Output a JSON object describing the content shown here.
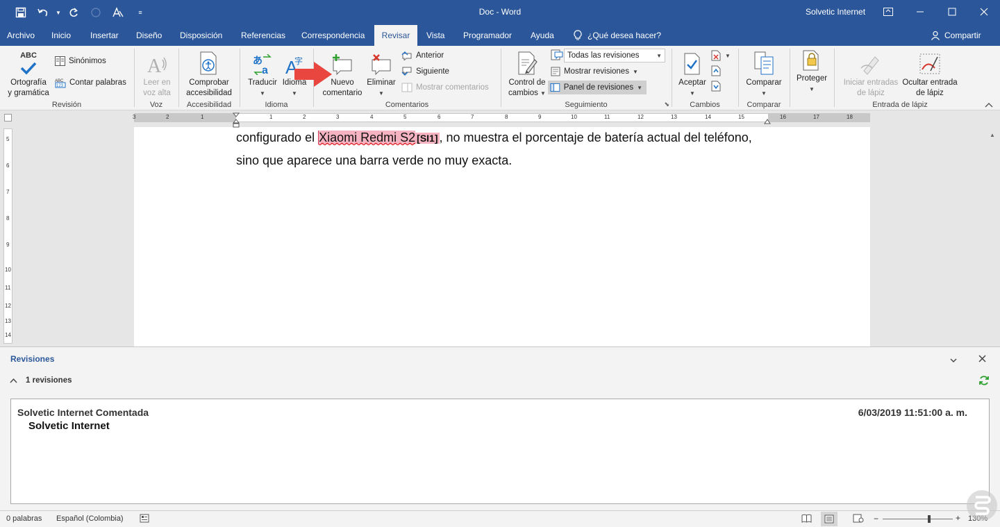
{
  "window": {
    "doc_title": "Doc - Word",
    "user": "Solvetic Internet",
    "qat_icons": [
      "save-icon",
      "undo-icon",
      "redo-icon",
      "autosave-icon",
      "touch-mode-icon",
      "customize-qat-icon"
    ],
    "buttons": [
      "ribbon-display-options-icon",
      "minimize-icon",
      "maximize-icon",
      "close-icon"
    ]
  },
  "tabs": [
    "Archivo",
    "Inicio",
    "Insertar",
    "Diseño",
    "Disposición",
    "Referencias",
    "Correspondencia",
    "Revisar",
    "Vista",
    "Programador",
    "Ayuda"
  ],
  "active_tab": "Revisar",
  "tell_me": "¿Qué desea hacer?",
  "share": "Compartir",
  "ribbon": {
    "revision": {
      "label": "Revisión",
      "spelling_1": "Ortografía",
      "spelling_2": "y gramática",
      "spelling_abc": "ABC",
      "thesaurus": "Sinónimos",
      "word_count": "Contar palabras"
    },
    "voz": {
      "label": "Voz",
      "read_1": "Leer en",
      "read_2": "voz alta"
    },
    "accesibilidad": {
      "label": "Accesibilidad",
      "check_1": "Comprobar",
      "check_2": "accesibilidad"
    },
    "idioma": {
      "label": "Idioma",
      "translate": "Traducir",
      "language": "Idioma"
    },
    "comentarios": {
      "label": "Comentarios",
      "new_1": "Nuevo",
      "new_2": "comentario",
      "delete": "Eliminar",
      "previous": "Anterior",
      "next": "Siguiente",
      "show": "Mostrar comentarios"
    },
    "seguimiento": {
      "label": "Seguimiento",
      "track_1": "Control de",
      "track_2": "cambios",
      "markup_combo": "Todas las revisiones",
      "show_markup": "Mostrar revisiones",
      "reviewing_pane": "Panel de revisiones"
    },
    "cambios": {
      "label": "Cambios",
      "accept": "Aceptar"
    },
    "comparar": {
      "label": "Comparar",
      "compare": "Comparar"
    },
    "proteger": {
      "protect": "Proteger"
    },
    "lapiz": {
      "label": "Entrada de lápiz",
      "start_1": "Iniciar entradas",
      "start_2": "de lápiz",
      "hide_1": "Ocultar entrada",
      "hide_2": "de lápiz"
    }
  },
  "ruler": {
    "h_numbers": [
      "3",
      "2",
      "1",
      "1",
      "2",
      "3",
      "4",
      "5",
      "6",
      "7",
      "8",
      "9",
      "10",
      "11",
      "12",
      "13",
      "14",
      "15",
      "16",
      "17",
      "18"
    ],
    "v_numbers": [
      "5",
      "6",
      "7",
      "8",
      "9",
      "10",
      "11",
      "12",
      "13",
      "14"
    ]
  },
  "document": {
    "line1_before": "configurado el ",
    "line1_highlight": "Xiaomi Redmi S2",
    "line1_comment_mark": "[SI1]",
    "line1_after": ", no muestra el porcentaje de batería actual del teléfono,",
    "line2": "sino que aparece una barra verde no muy exacta."
  },
  "revisions_pane": {
    "title": "Revisiones",
    "count": "1 revisiones",
    "author": "Solvetic Internet  Comentada",
    "date": "6/03/2019 11:51:00 a. m.",
    "comment": "Solvetic Internet"
  },
  "status": {
    "words": "0 palabras",
    "language": "Español (Colombia)",
    "zoom": "130%",
    "zoom_level": 0.64
  },
  "colors": {
    "brand": "#2b579a",
    "highlight": "#f5b3c1",
    "arrow": "#e8463e",
    "check_blue": "#1e72c7",
    "refresh_green": "#2ca02c"
  }
}
